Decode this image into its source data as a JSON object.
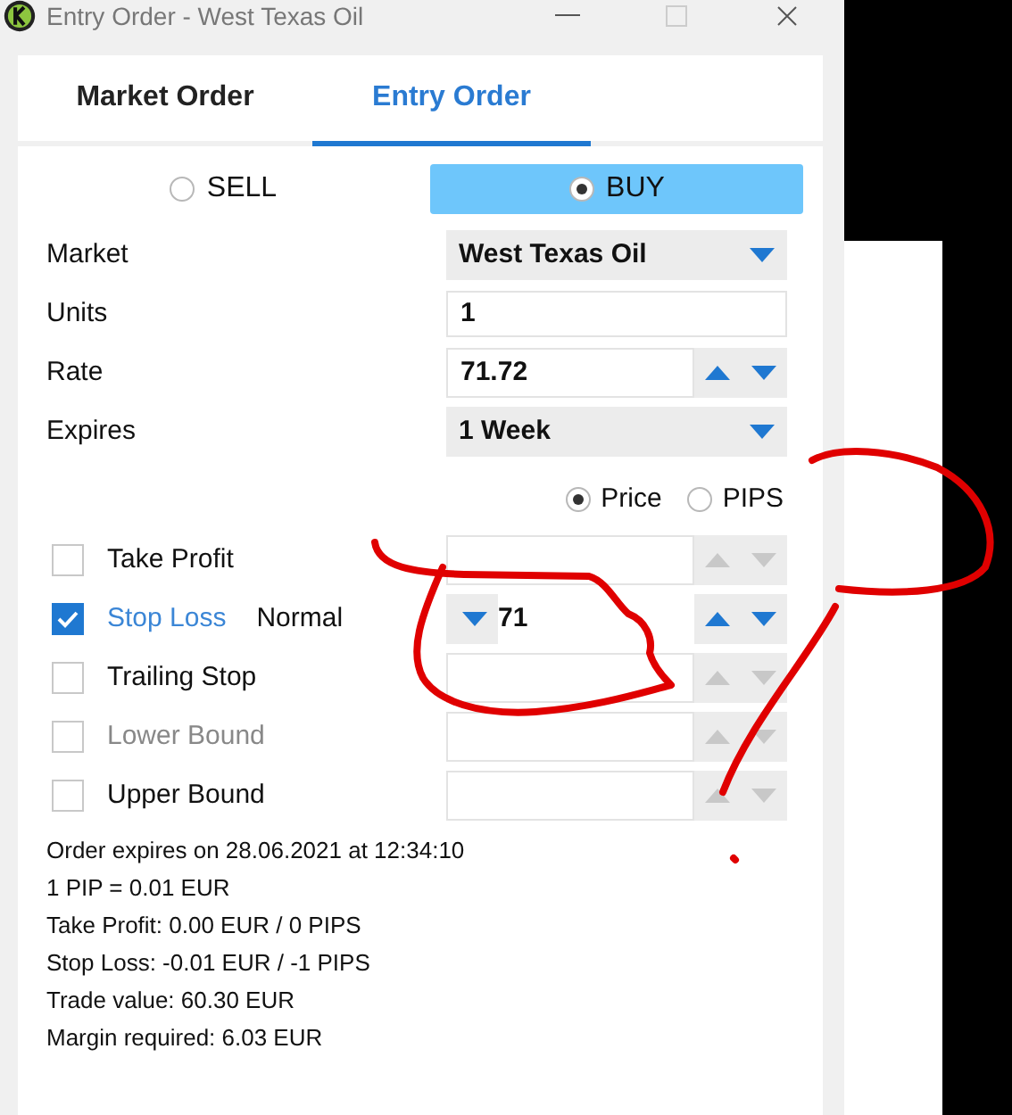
{
  "window": {
    "title": "Entry Order - West Texas Oil"
  },
  "tabs": [
    {
      "label": "Market Order",
      "selected": false
    },
    {
      "label": "Entry Order",
      "selected": true
    }
  ],
  "direction": [
    {
      "label": "SELL",
      "selected": false
    },
    {
      "label": "BUY",
      "selected": true
    }
  ],
  "fields": [
    {
      "label": "Market",
      "kind": "dropdown",
      "value": "West Texas Oil"
    },
    {
      "label": "Units",
      "kind": "input",
      "value": "1"
    },
    {
      "label": "Rate",
      "kind": "spinner",
      "value": "71.72"
    },
    {
      "label": "Expires",
      "kind": "dropdown",
      "value": "1 Week"
    }
  ],
  "rate_mode": [
    {
      "label": "Price",
      "selected": true
    },
    {
      "label": "PIPS",
      "selected": false
    }
  ],
  "conditions": [
    {
      "label": "Take Profit",
      "checked": false,
      "disabled": false
    },
    {
      "label": "Stop Loss",
      "checked": true,
      "disabled": false,
      "mode": "Normal",
      "value": "71"
    },
    {
      "label": "Trailing Stop",
      "checked": false,
      "disabled": false
    },
    {
      "label": "Lower Bound",
      "checked": false,
      "disabled": true
    },
    {
      "label": "Upper Bound",
      "checked": false,
      "disabled": false
    }
  ],
  "info": [
    "Order expires on 28.06.2021 at 12:34:10",
    "1 PIP = 0.01 EUR",
    "Take Profit: 0.00 EUR / 0 PIPS",
    "Stop Loss: -0.01 EUR / -1 PIPS",
    "Trade value: 60.30 EUR",
    "Margin required: 6.03 EUR"
  ]
}
